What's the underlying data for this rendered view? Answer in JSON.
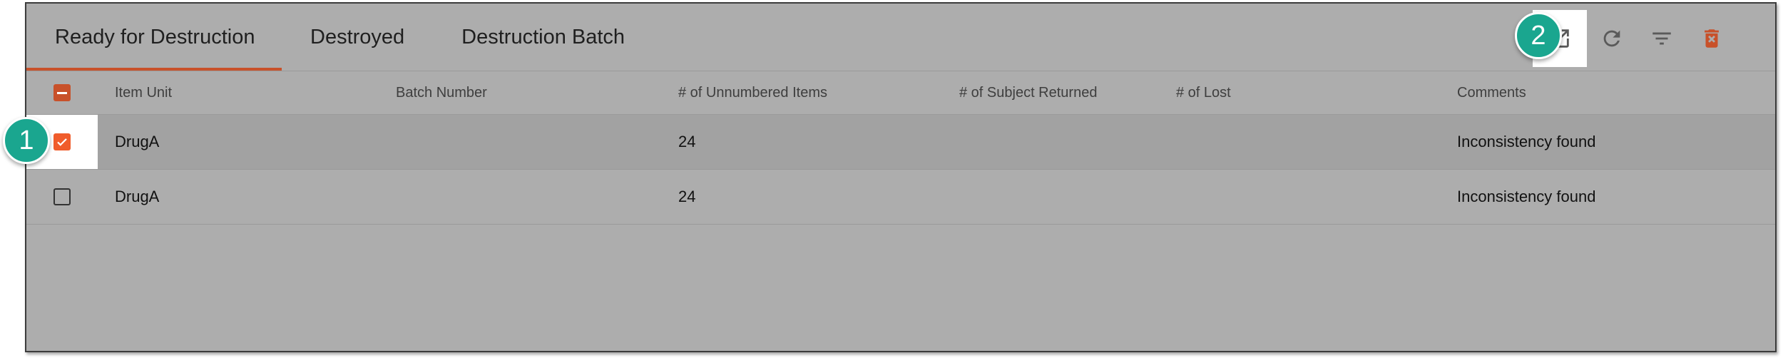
{
  "tabs": [
    {
      "label": "Ready for Destruction",
      "active": true
    },
    {
      "label": "Destroyed",
      "active": false
    },
    {
      "label": "Destruction Batch",
      "active": false
    }
  ],
  "toolbar": {
    "icons": [
      "open-in-new-icon",
      "refresh-icon",
      "filter-icon",
      "delete-icon"
    ],
    "accent": "#c8512a"
  },
  "table": {
    "columns": [
      "Item Unit",
      "Batch Number",
      "# of Unnumbered Items",
      "# of Subject Returned",
      "# of Lost",
      "Comments"
    ],
    "rows": [
      {
        "checked": true,
        "item_unit": "DrugA",
        "batch_number": "",
        "unnumbered": "24",
        "subject_returned": "",
        "lost": "",
        "comments": "Inconsistency found"
      },
      {
        "checked": false,
        "item_unit": "DrugA",
        "batch_number": "",
        "unnumbered": "24",
        "subject_returned": "",
        "lost": "",
        "comments": "Inconsistency found"
      }
    ]
  },
  "callouts": {
    "one": "1",
    "two": "2",
    "color": "#1aa68f"
  }
}
